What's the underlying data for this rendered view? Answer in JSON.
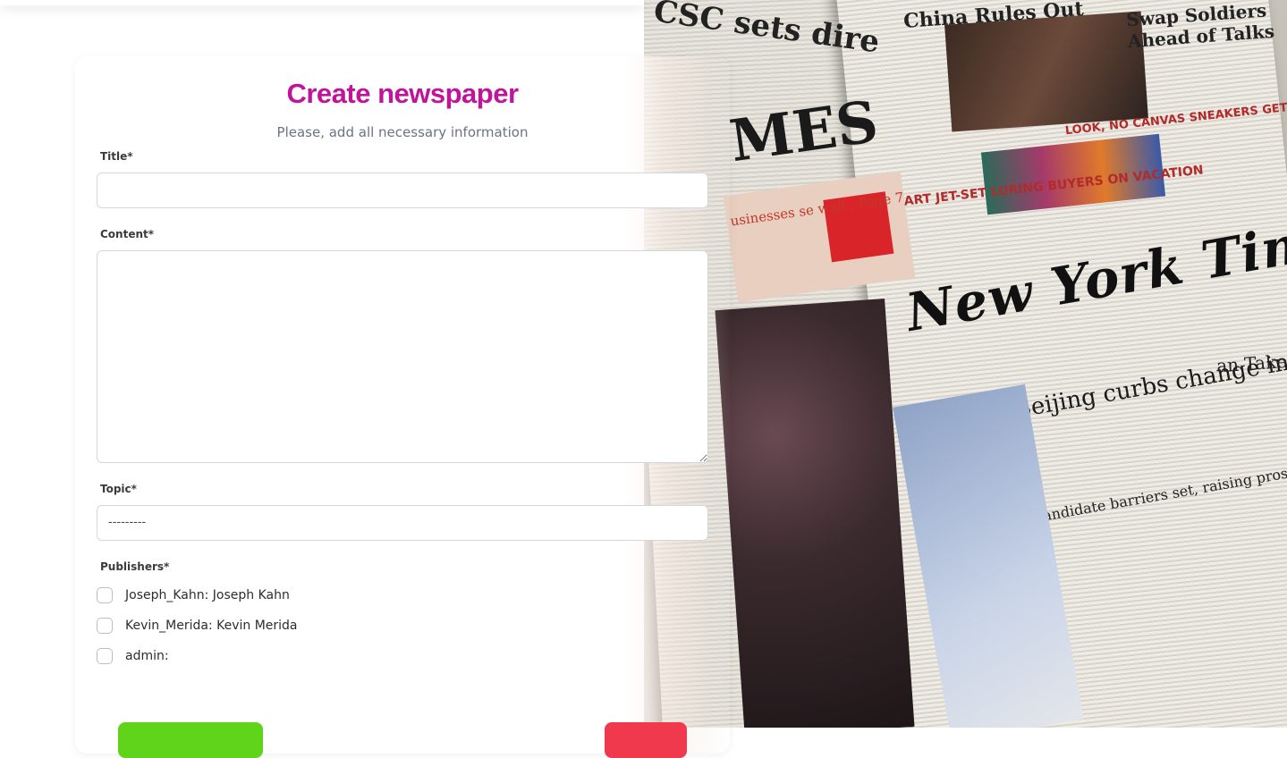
{
  "form": {
    "title": "Create newspaper",
    "subtitle": "Please, add all necessary information",
    "fields": {
      "title_label": "Title*",
      "title_value": "",
      "content_label": "Content*",
      "content_value": "",
      "topic_label": "Topic*",
      "topic_selected": "---------",
      "publishers_label": "Publishers*"
    },
    "publishers": [
      {
        "label": "Joseph_Kahn: Joseph Kahn",
        "checked": false
      },
      {
        "label": "Kevin_Merida: Kevin Merida",
        "checked": false
      },
      {
        "label": "admin:",
        "checked": false
      }
    ]
  },
  "colors": {
    "accent": "#c0159b",
    "submit": "#5fd41a",
    "cancel": "#f0394d"
  },
  "background_photo": {
    "masthead_1": "CSC sets dire",
    "masthead_2": "China Rules Out",
    "masthead_3": "Swap Soldiers Ahead of Talks",
    "times_fragment": "MES",
    "banner_text": "usinesses se wall , Page 7",
    "ad_text": "ART JET-SET LURING BUYERS ON VACATION",
    "ad_text_2": "LOOK, NO CANVAS SNEAKERS GET A TRIM REBOOT",
    "newspaper_name": "New York Times",
    "headline": "Beijing curbs change in Hong Kong voting",
    "subhead": "Candidate barriers set, raising prospect of clash with democracy drive",
    "side_text": "an Takes n With It"
  }
}
